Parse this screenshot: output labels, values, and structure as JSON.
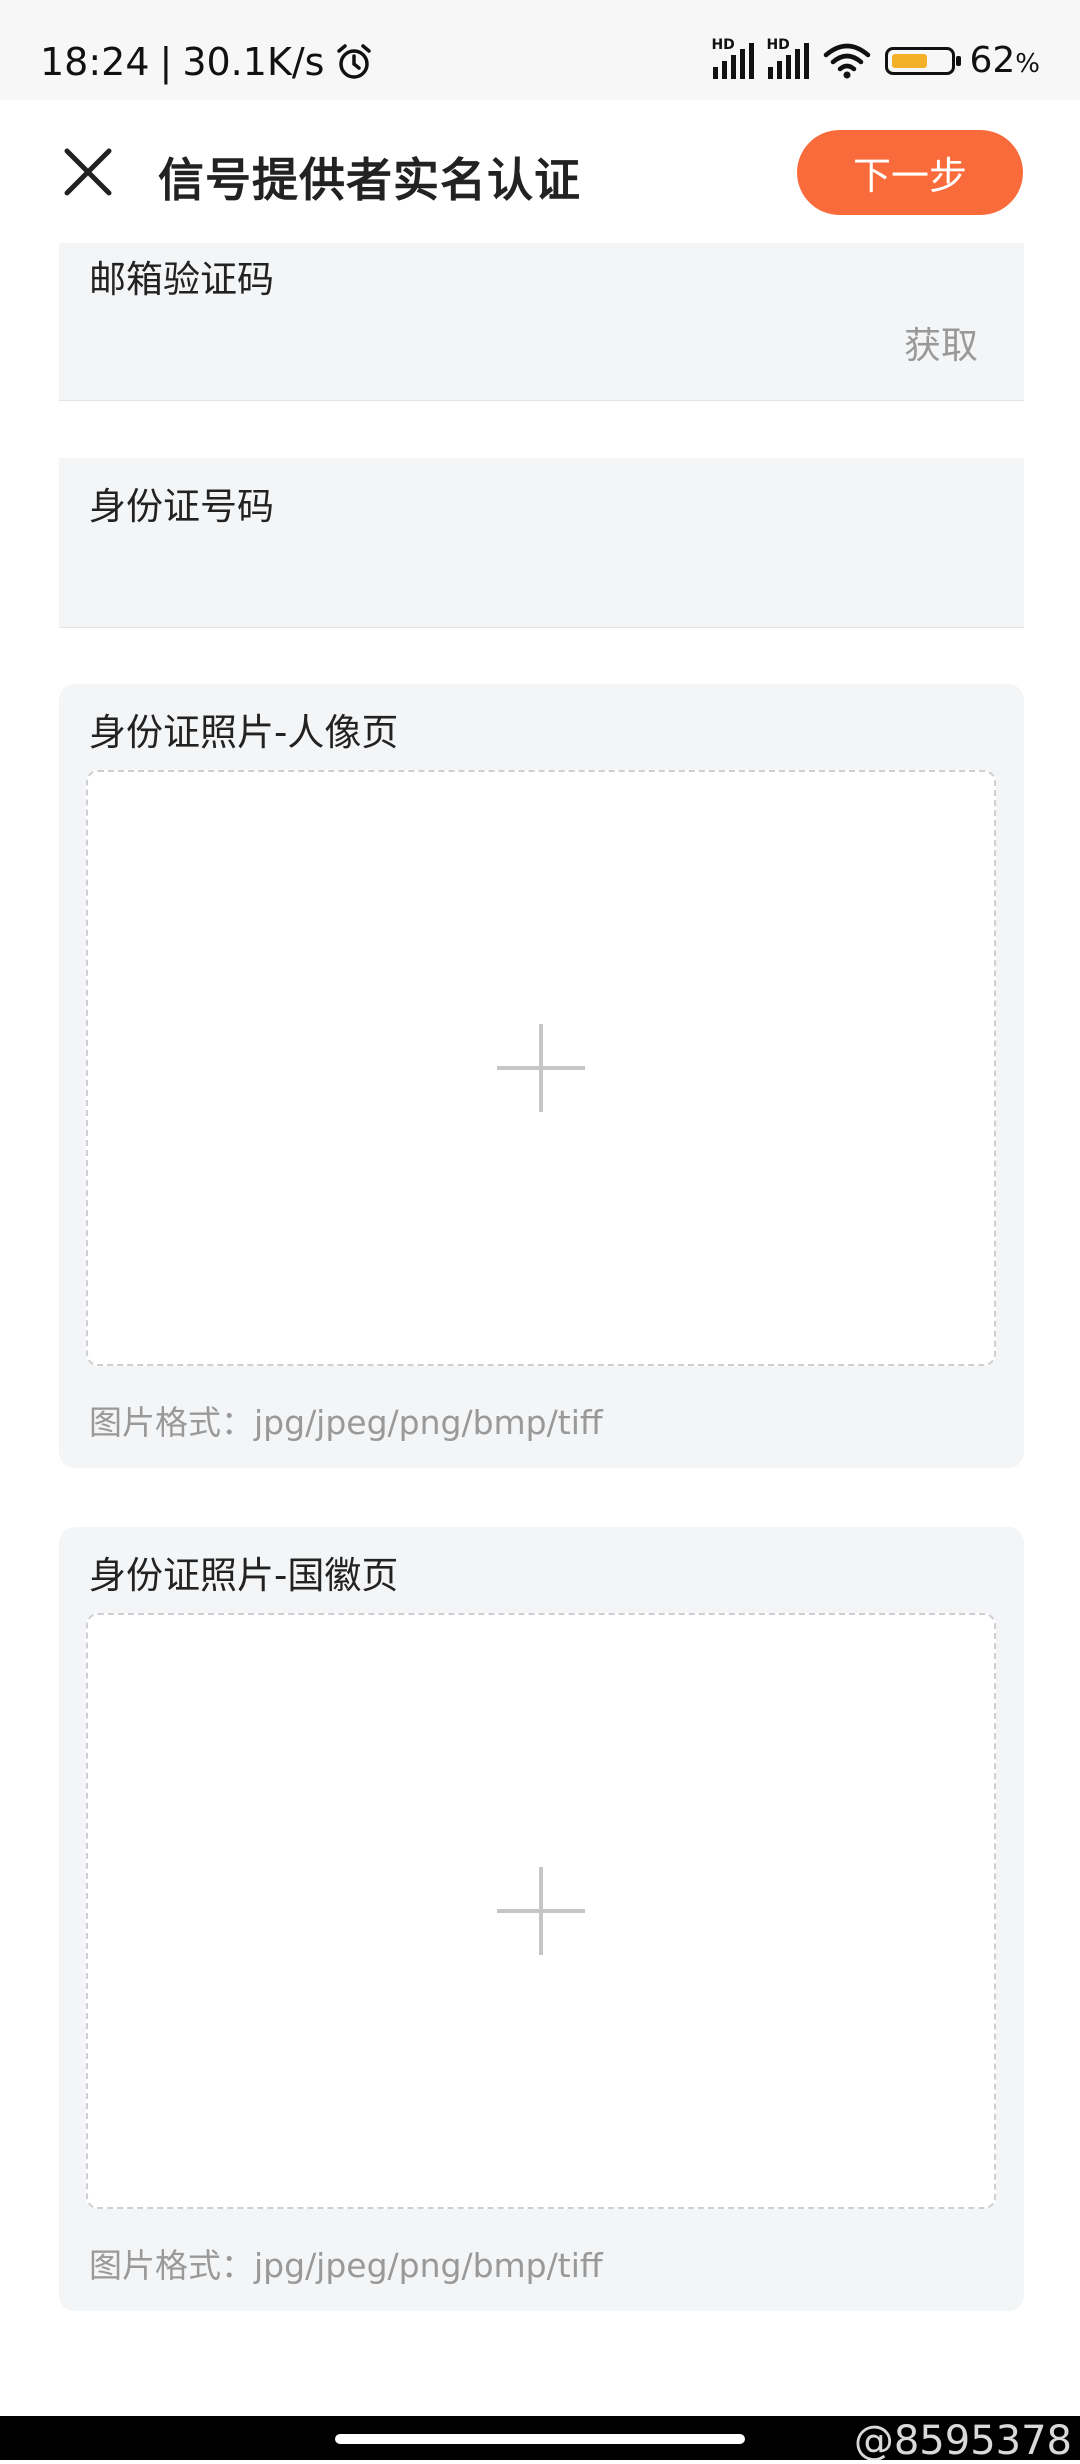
{
  "status_bar": {
    "time": "18:24",
    "speed": "30.1K/s",
    "alarm_icon": "alarm-clock-icon",
    "signal_label": "HD",
    "battery_percent": "62",
    "battery_suffix": "%",
    "battery_level": 0.62,
    "battery_color": "#f2b128"
  },
  "header": {
    "title": "信号提供者实名认证",
    "close_icon": "close-icon",
    "next_label": "下一步",
    "next_color": "#f96b3a"
  },
  "form": {
    "email_code_label": "邮箱验证码",
    "get_code_label": "获取",
    "id_number_label": "身份证号码"
  },
  "photo_front": {
    "label": "身份证照片-人像页",
    "format_hint": "图片格式：jpg/jpeg/png/bmp/tiff"
  },
  "photo_back": {
    "label": "身份证照片-国徽页",
    "format_hint": "图片格式：jpg/jpeg/png/bmp/tiff"
  },
  "watermark": "@8595378"
}
